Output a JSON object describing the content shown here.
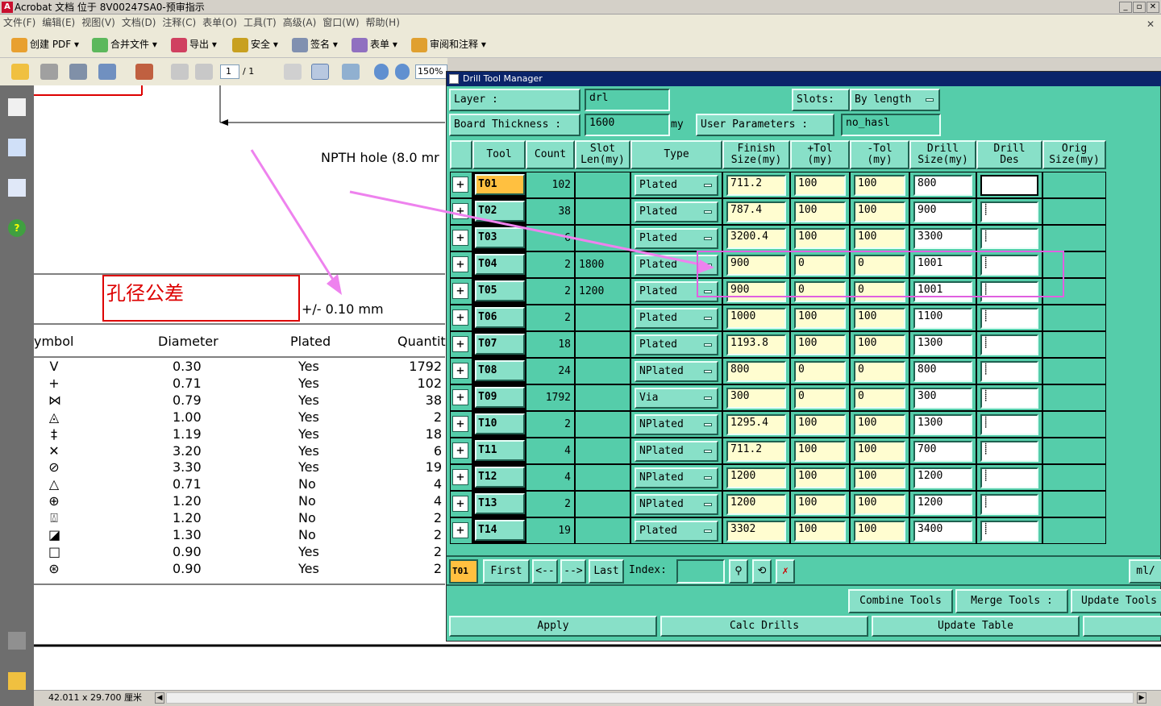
{
  "app": {
    "title": "Acrobat 文档 位于 8V00247SA0-预审指示",
    "menu": [
      "文件(F)",
      "编辑(E)",
      "视图(V)",
      "文档(D)",
      "注释(C)",
      "表单(O)",
      "工具(T)",
      "高级(A)",
      "窗口(W)",
      "帮助(H)"
    ],
    "toolbar": [
      "创建 PDF",
      "合并文件",
      "导出",
      "安全",
      "签名",
      "表单",
      "审阅和注释"
    ],
    "page_current": "1",
    "page_total": "/ 1",
    "zoom": "150%",
    "status_size": "42.011 x 29.700 厘米"
  },
  "doc": {
    "npth_note": "NPTH hole (8.0 mr",
    "tolerance_label": "孔径公差",
    "tolerance_value": "+/- 0.10 mm",
    "legend_headers": {
      "symbol": "ymbol",
      "diameter": "Diameter",
      "plated": "Plated",
      "quantity": "Quantit"
    },
    "legend_rows": [
      {
        "sym": "V",
        "dia": "0.30",
        "plated": "Yes",
        "qty": "1792"
      },
      {
        "sym": "+",
        "dia": "0.71",
        "plated": "Yes",
        "qty": "102"
      },
      {
        "sym": "⋈",
        "dia": "0.79",
        "plated": "Yes",
        "qty": "38"
      },
      {
        "sym": "◬",
        "dia": "1.00",
        "plated": "Yes",
        "qty": "2"
      },
      {
        "sym": "‡",
        "dia": "1.19",
        "plated": "Yes",
        "qty": "18"
      },
      {
        "sym": "✕",
        "dia": "3.20",
        "plated": "Yes",
        "qty": "6"
      },
      {
        "sym": "⊘",
        "dia": "3.30",
        "plated": "Yes",
        "qty": "19"
      },
      {
        "sym": "△",
        "dia": "0.71",
        "plated": "No",
        "qty": "4"
      },
      {
        "sym": "⊕",
        "dia": "1.20",
        "plated": "No",
        "qty": "4"
      },
      {
        "sym": "⍍",
        "dia": "1.20",
        "plated": "No",
        "qty": "2"
      },
      {
        "sym": "◪",
        "dia": "1.30",
        "plated": "No",
        "qty": "2"
      },
      {
        "sym": "□",
        "dia": "0.90",
        "plated": "Yes",
        "qty": "2"
      },
      {
        "sym": "⊛",
        "dia": "0.90",
        "plated": "Yes",
        "qty": "2"
      }
    ]
  },
  "dtm": {
    "title": "Drill Tool Manager",
    "layer_label": "Layer          :",
    "layer_value": "drl",
    "slots_label": "Slots:",
    "slots_value": "By length",
    "board_thickness_label": "Board Thickness  :",
    "board_thickness_value": "1600",
    "board_thickness_unit": "my",
    "user_params_label": "User Parameters :",
    "user_params_value": "no_hasl",
    "headers": {
      "tool": "Tool",
      "count": "Count",
      "slot": "Slot\nLen(my)",
      "type": "Type",
      "finish": "Finish\nSize(my)",
      "ptol": "+Tol\n(my)",
      "mtol": "-Tol\n(my)",
      "drill": "Drill\nSize(my)",
      "des": "Drill\nDes",
      "orig": "Orig\nSize(my)"
    },
    "rows": [
      {
        "tool": "T01",
        "count": "102",
        "slot": "",
        "type": "Plated",
        "finish": "711.2",
        "ptol": "100",
        "mtol": "100",
        "drill": "800"
      },
      {
        "tool": "T02",
        "count": "38",
        "slot": "",
        "type": "Plated",
        "finish": "787.4",
        "ptol": "100",
        "mtol": "100",
        "drill": "900"
      },
      {
        "tool": "T03",
        "count": "6",
        "slot": "",
        "type": "Plated",
        "finish": "3200.4",
        "ptol": "100",
        "mtol": "100",
        "drill": "3300"
      },
      {
        "tool": "T04",
        "count": "2",
        "slot": "1800",
        "type": "Plated",
        "finish": "900",
        "ptol": "0",
        "mtol": "0",
        "drill": "1001"
      },
      {
        "tool": "T05",
        "count": "2",
        "slot": "1200",
        "type": "Plated",
        "finish": "900",
        "ptol": "0",
        "mtol": "0",
        "drill": "1001"
      },
      {
        "tool": "T06",
        "count": "2",
        "slot": "",
        "type": "Plated",
        "finish": "1000",
        "ptol": "100",
        "mtol": "100",
        "drill": "1100"
      },
      {
        "tool": "T07",
        "count": "18",
        "slot": "",
        "type": "Plated",
        "finish": "1193.8",
        "ptol": "100",
        "mtol": "100",
        "drill": "1300"
      },
      {
        "tool": "T08",
        "count": "24",
        "slot": "",
        "type": "NPlated",
        "finish": "800",
        "ptol": "0",
        "mtol": "0",
        "drill": "800"
      },
      {
        "tool": "T09",
        "count": "1792",
        "slot": "",
        "type": "Via",
        "finish": "300",
        "ptol": "0",
        "mtol": "0",
        "drill": "300"
      },
      {
        "tool": "T10",
        "count": "2",
        "slot": "",
        "type": "NPlated",
        "finish": "1295.4",
        "ptol": "100",
        "mtol": "100",
        "drill": "1300"
      },
      {
        "tool": "T11",
        "count": "4",
        "slot": "",
        "type": "NPlated",
        "finish": "711.2",
        "ptol": "100",
        "mtol": "100",
        "drill": "700"
      },
      {
        "tool": "T12",
        "count": "4",
        "slot": "",
        "type": "NPlated",
        "finish": "1200",
        "ptol": "100",
        "mtol": "100",
        "drill": "1200"
      },
      {
        "tool": "T13",
        "count": "2",
        "slot": "",
        "type": "NPlated",
        "finish": "1200",
        "ptol": "100",
        "mtol": "100",
        "drill": "1200"
      },
      {
        "tool": "T14",
        "count": "19",
        "slot": "",
        "type": "Plated",
        "finish": "3302",
        "ptol": "100",
        "mtol": "100",
        "drill": "3400"
      }
    ],
    "current_tool": "T01",
    "nav": {
      "first": "First",
      "prev": "<--",
      "next": "-->",
      "last": "Last",
      "index_label": "Index:",
      "units": "ml/"
    },
    "buttons": {
      "combine": "Combine Tools",
      "merge": "Merge Tools :",
      "update_tools": "Update Tools",
      "apply": "Apply",
      "calc": "Calc Drills",
      "update_table": "Update Table"
    }
  },
  "colors": {
    "accent_pink": "#ee82ee",
    "highlight_magenta": "#e060e0",
    "panel_green": "#55cdaa",
    "red_box": "#dd0000"
  }
}
